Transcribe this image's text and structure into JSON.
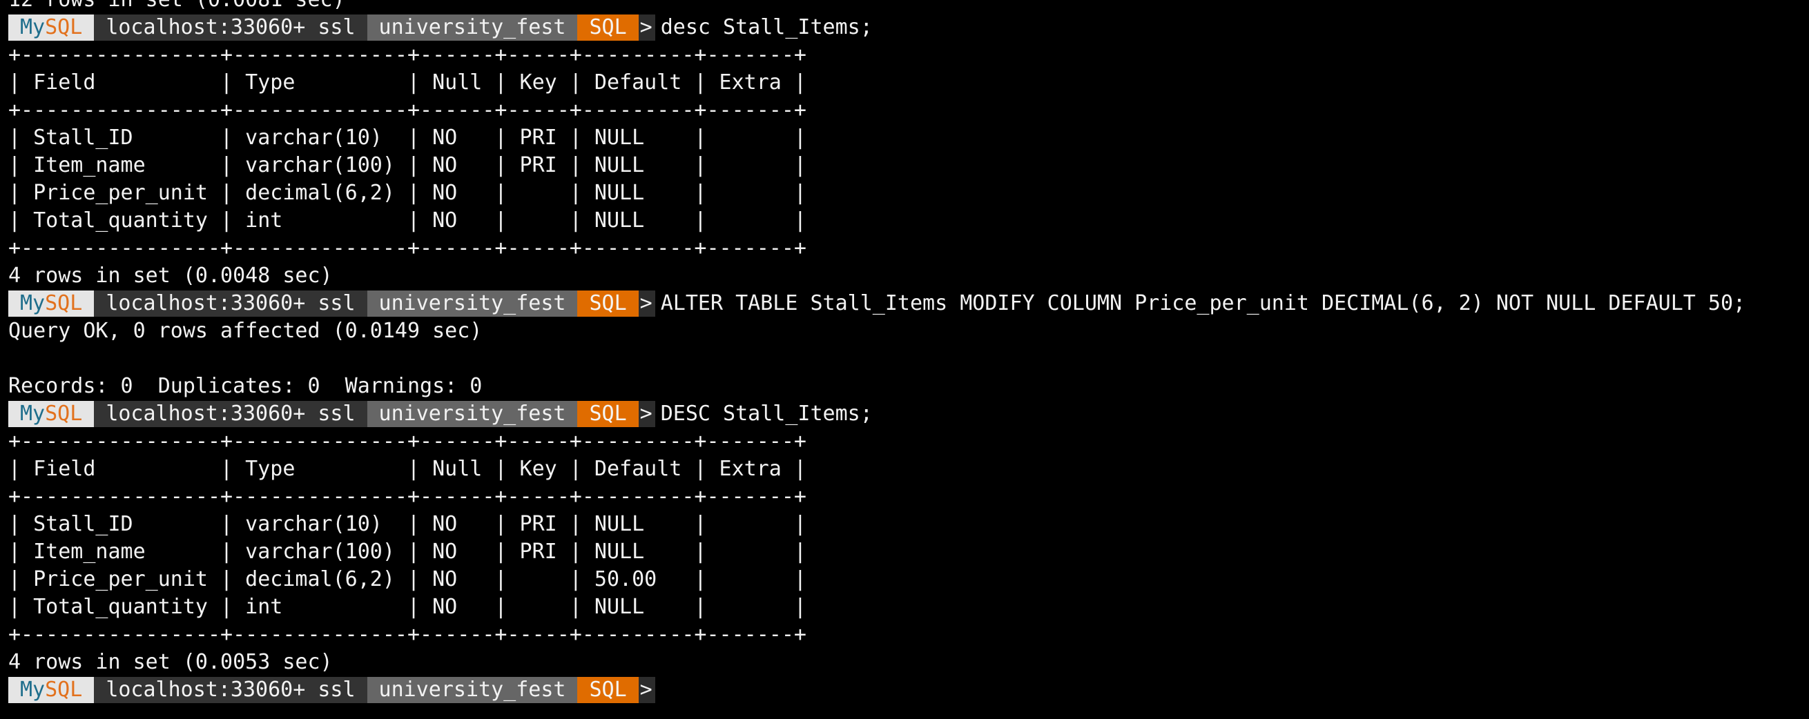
{
  "colors": {
    "background": "#000000",
    "text": "#f2f2f2",
    "mysql_badge_bg": "#e5e5e5",
    "mysql_my": "#1f6e8c",
    "mysql_sql": "#e2711d",
    "host_bg": "#333333",
    "database_bg": "#666666",
    "mode_bg": "#e06c00"
  },
  "prompt": {
    "brand_part1": "My",
    "brand_part2": "SQL",
    "host": "localhost:33060+ ssl",
    "database": "university_fest",
    "mode": "SQL",
    "arrow": ">"
  },
  "lines": [
    {
      "type": "text",
      "text": "12 rows in set (0.0081 sec)"
    },
    {
      "type": "prompt",
      "command": "desc Stall_Items;"
    },
    {
      "type": "text",
      "text": "+----------------+--------------+------+-----+---------+-------+"
    },
    {
      "type": "text",
      "text": "| Field          | Type         | Null | Key | Default | Extra |"
    },
    {
      "type": "text",
      "text": "+----------------+--------------+------+-----+---------+-------+"
    },
    {
      "type": "text",
      "text": "| Stall_ID       | varchar(10)  | NO   | PRI | NULL    |       |"
    },
    {
      "type": "text",
      "text": "| Item_name      | varchar(100) | NO   | PRI | NULL    |       |"
    },
    {
      "type": "text",
      "text": "| Price_per_unit | decimal(6,2) | NO   |     | NULL    |       |"
    },
    {
      "type": "text",
      "text": "| Total_quantity | int          | NO   |     | NULL    |       |"
    },
    {
      "type": "text",
      "text": "+----------------+--------------+------+-----+---------+-------+"
    },
    {
      "type": "text",
      "text": "4 rows in set (0.0048 sec)"
    },
    {
      "type": "prompt",
      "command": "ALTER TABLE Stall_Items MODIFY COLUMN Price_per_unit DECIMAL(6, 2) NOT NULL DEFAULT 50;"
    },
    {
      "type": "text",
      "text": "Query OK, 0 rows affected (0.0149 sec)"
    },
    {
      "type": "text",
      "text": ""
    },
    {
      "type": "text",
      "text": "Records: 0  Duplicates: 0  Warnings: 0"
    },
    {
      "type": "prompt",
      "command": "DESC Stall_Items;"
    },
    {
      "type": "text",
      "text": "+----------------+--------------+------+-----+---------+-------+"
    },
    {
      "type": "text",
      "text": "| Field          | Type         | Null | Key | Default | Extra |"
    },
    {
      "type": "text",
      "text": "+----------------+--------------+------+-----+---------+-------+"
    },
    {
      "type": "text",
      "text": "| Stall_ID       | varchar(10)  | NO   | PRI | NULL    |       |"
    },
    {
      "type": "text",
      "text": "| Item_name      | varchar(100) | NO   | PRI | NULL    |       |"
    },
    {
      "type": "text",
      "text": "| Price_per_unit | decimal(6,2) | NO   |     | 50.00   |       |"
    },
    {
      "type": "text",
      "text": "| Total_quantity | int          | NO   |     | NULL    |       |"
    },
    {
      "type": "text",
      "text": "+----------------+--------------+------+-----+---------+-------+"
    },
    {
      "type": "text",
      "text": "4 rows in set (0.0053 sec)"
    },
    {
      "type": "prompt",
      "command": ""
    }
  ]
}
